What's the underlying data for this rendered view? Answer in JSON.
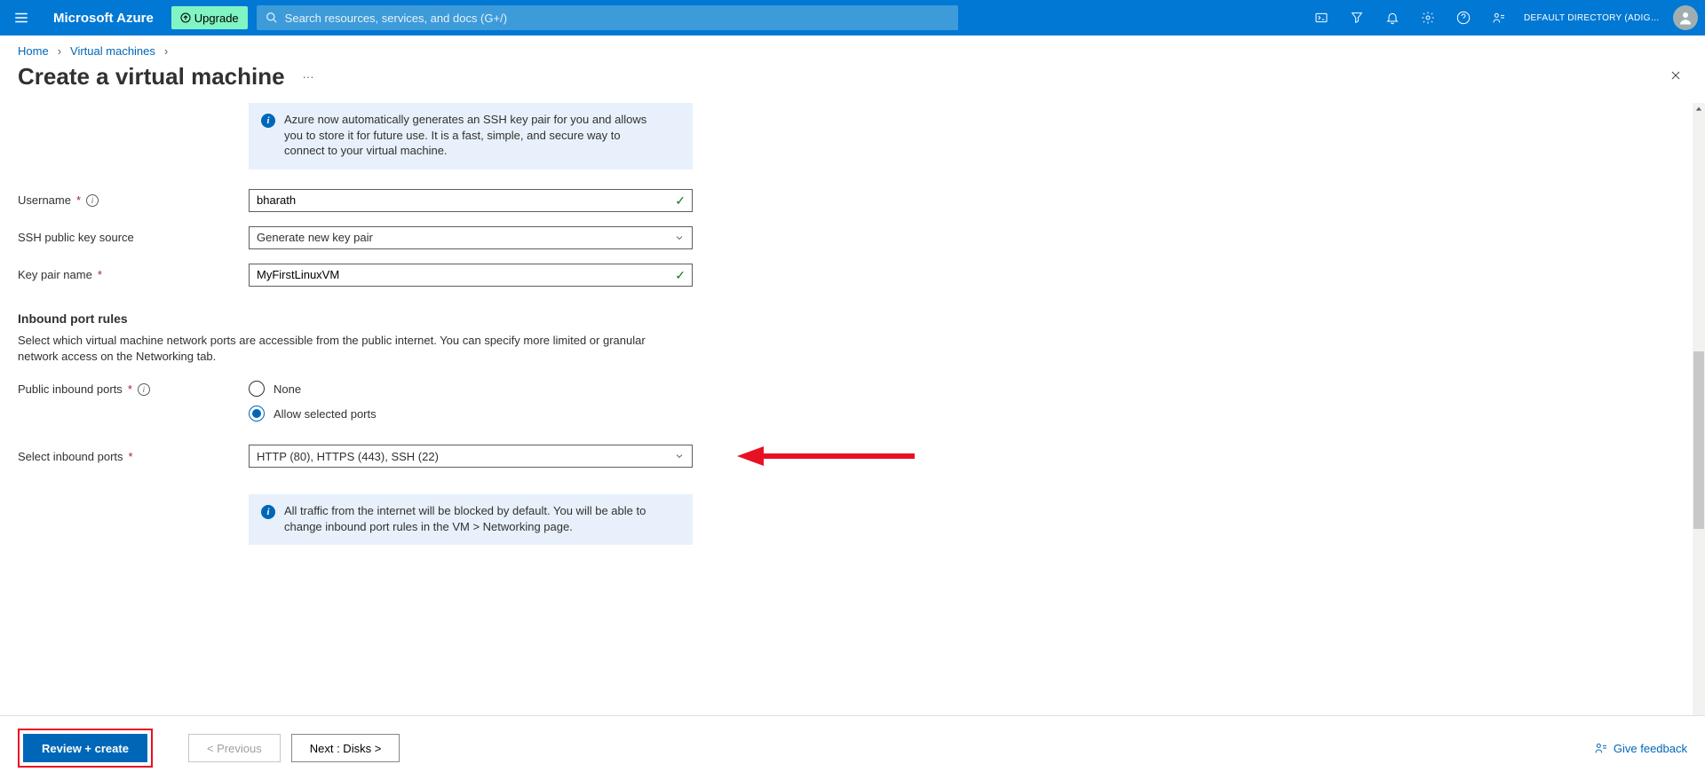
{
  "topbar": {
    "brand": "Microsoft Azure",
    "upgrade_label": "Upgrade",
    "search_placeholder": "Search resources, services, and docs (G+/)",
    "directory_label": "DEFAULT DIRECTORY (ADIGOPUL..."
  },
  "breadcrumb": {
    "home": "Home",
    "vms": "Virtual machines"
  },
  "page_title": "Create a virtual machine",
  "info_ssh": "Azure now automatically generates an SSH key pair for you and allows you to store it for future use. It is a fast, simple, and secure way to connect to your virtual machine.",
  "fields": {
    "username_label": "Username",
    "username_value": "bharath",
    "ssh_source_label": "SSH public key source",
    "ssh_source_value": "Generate new key pair",
    "keypair_label": "Key pair name",
    "keypair_value": "MyFirstLinuxVM"
  },
  "inbound": {
    "heading": "Inbound port rules",
    "description": "Select which virtual machine network ports are accessible from the public internet. You can specify more limited or granular network access on the Networking tab.",
    "public_label": "Public inbound ports",
    "radio_none": "None",
    "radio_allow": "Allow selected ports",
    "select_label": "Select inbound ports",
    "select_value": "HTTP (80), HTTPS (443), SSH (22)",
    "info_traffic": "All traffic from the internet will be blocked by default. You will be able to change inbound port rules in the VM > Networking page."
  },
  "footer": {
    "review_create": "Review + create",
    "previous": "< Previous",
    "next": "Next : Disks >",
    "feedback": "Give feedback"
  }
}
